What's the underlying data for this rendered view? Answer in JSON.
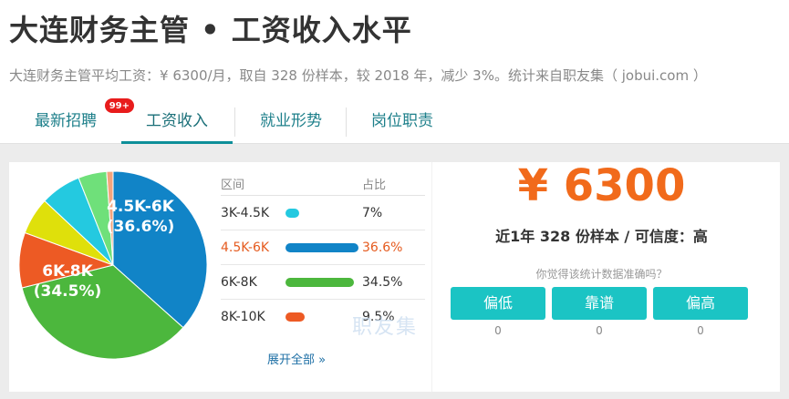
{
  "header": {
    "title": "大连财务主管 • 工资收入水平",
    "subtitle": "大连财务主管平均工资：¥ 6300/月，取自 328 份样本，较 2018 年，减少 3%。统计来自职友集（ jobui.com ）"
  },
  "tabs": [
    {
      "label": "最新招聘",
      "badge": "99+"
    },
    {
      "label": "工资收入",
      "active": true
    },
    {
      "label": "就业形势"
    },
    {
      "label": "岗位职责"
    }
  ],
  "pie_labels": [
    {
      "range": "4.5K-6K",
      "pct": "(36.6%)"
    },
    {
      "range": "6K-8K",
      "pct": "(34.5%)"
    }
  ],
  "distribution": {
    "header_range": "区间",
    "header_pct": "占比",
    "rows": [
      {
        "range": "3K-4.5K",
        "pct": "7%",
        "value": 7,
        "color": "#24c9e0"
      },
      {
        "range": "4.5K-6K",
        "pct": "36.6%",
        "value": 36.6,
        "color": "#1184c7",
        "highlight": true
      },
      {
        "range": "6K-8K",
        "pct": "34.5%",
        "value": 34.5,
        "color": "#4cb73d"
      },
      {
        "range": "8K-10K",
        "pct": "9.5%",
        "value": 9.5,
        "color": "#ed5a24"
      }
    ],
    "expand_label": "展开全部 »",
    "watermark": "职友集"
  },
  "pie_slices": [
    {
      "value": 36.6,
      "color": "#1184c7"
    },
    {
      "value": 34.5,
      "color": "#4cb73d"
    },
    {
      "value": 9.5,
      "color": "#ed5a24"
    },
    {
      "value": 6.4,
      "color": "#dfe00b"
    },
    {
      "value": 7,
      "color": "#24c9e0"
    },
    {
      "value": 4.9,
      "color": "#6fe07a"
    },
    {
      "value": 1.1,
      "color": "#f4a47d"
    }
  ],
  "summary": {
    "average": "¥ 6300",
    "desc": "近1年 328 份样本 / 可信度：高",
    "question": "你觉得该统计数据准确吗？",
    "votes": [
      {
        "label": "偏低",
        "count": "0"
      },
      {
        "label": "靠谱",
        "count": "0"
      },
      {
        "label": "偏高",
        "count": "0"
      }
    ]
  }
}
